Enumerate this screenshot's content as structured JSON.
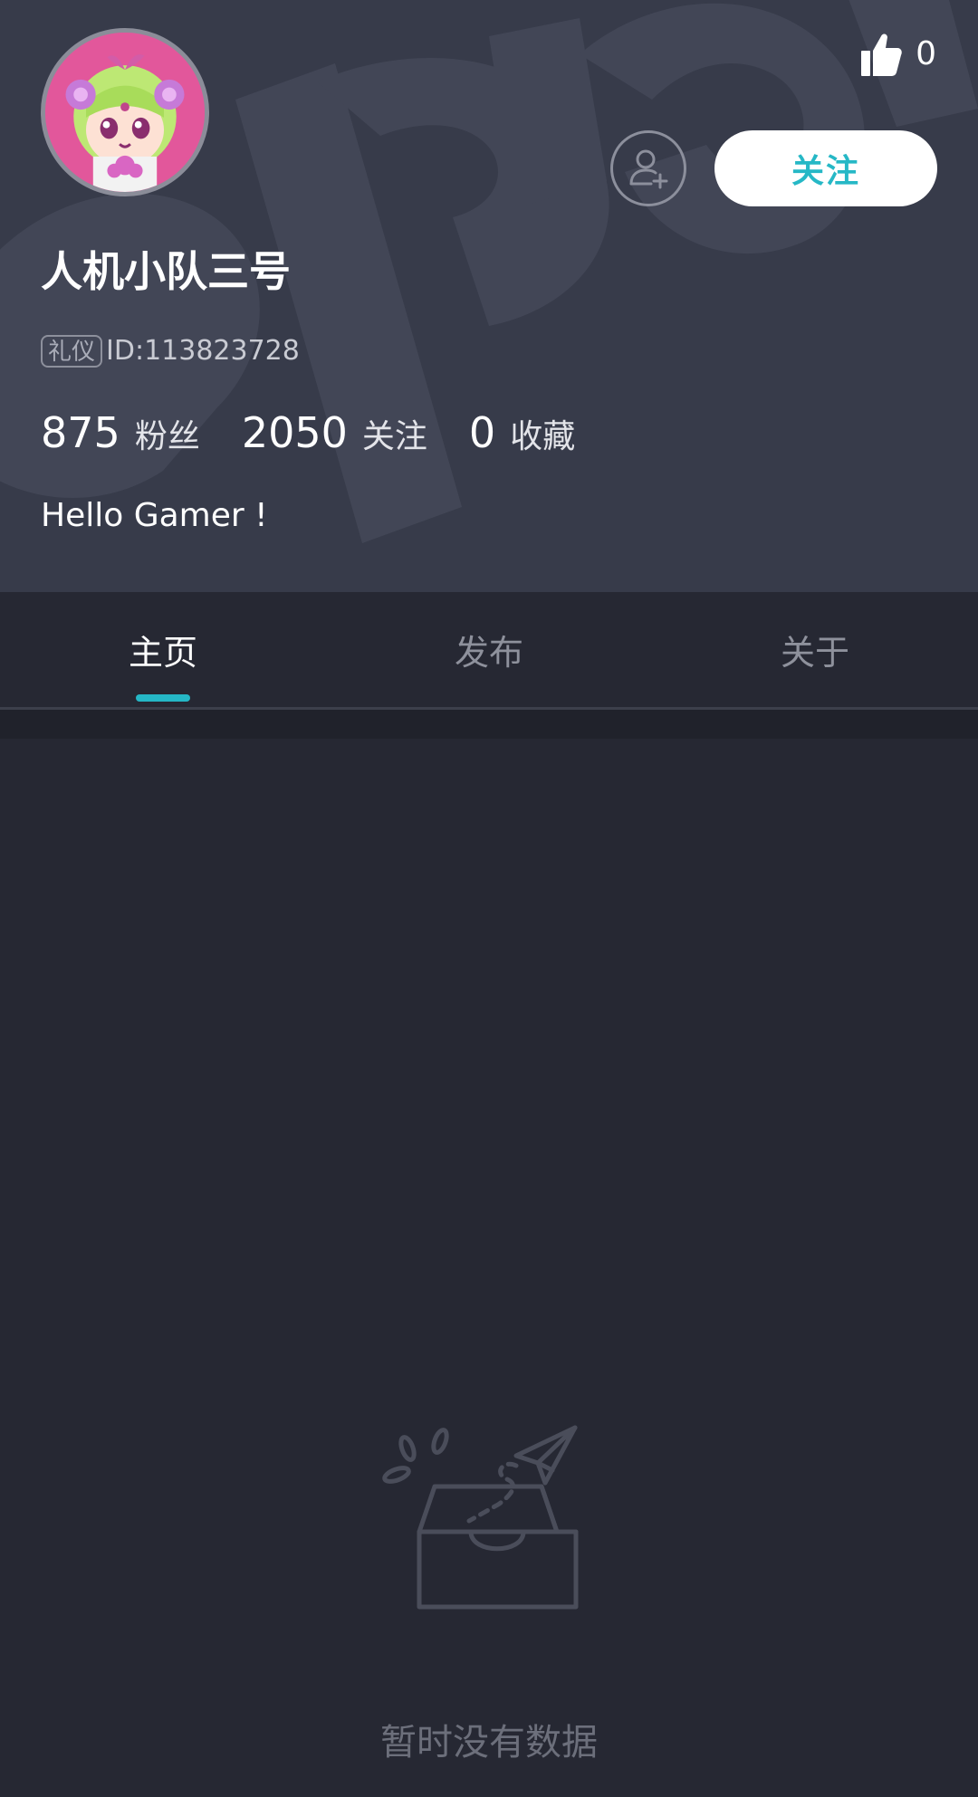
{
  "profile": {
    "username": "人机小队三号",
    "title_badge": "礼仪",
    "user_id": "ID:113823728",
    "bio": "Hello Gamer !",
    "likes": "0",
    "follow_label": "关注"
  },
  "stats": [
    {
      "value": "875",
      "label": "粉丝"
    },
    {
      "value": "2050",
      "label": "关注"
    },
    {
      "value": "0",
      "label": "收藏"
    }
  ],
  "tabs": [
    {
      "label": "主页",
      "active": true
    },
    {
      "label": "发布",
      "active": false
    },
    {
      "label": "关于",
      "active": false
    }
  ],
  "empty_state": {
    "text": "暂时没有数据"
  },
  "colors": {
    "accent": "#25b7c6",
    "header_bg": "#373b4a",
    "page_bg": "#262833"
  },
  "icons": {
    "like": "thumbs-up-icon",
    "add_friend": "add-user-icon",
    "empty": "empty-inbox-icon"
  }
}
